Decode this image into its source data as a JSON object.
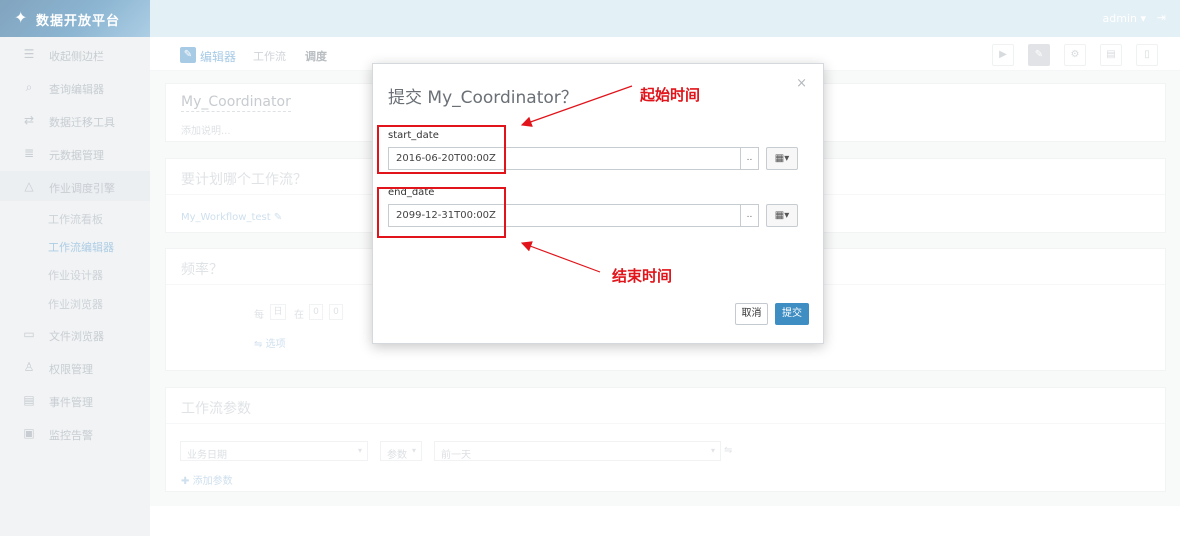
{
  "sidebar": {
    "brand": "数据开放平台",
    "items": [
      {
        "label": "收起侧边栏"
      },
      {
        "label": "查询编辑器"
      },
      {
        "label": "数据迁移工具"
      },
      {
        "label": "元数据管理"
      },
      {
        "label": "作业调度引擎"
      },
      {
        "label": "文件浏览器"
      },
      {
        "label": "权限管理"
      },
      {
        "label": "事件管理"
      },
      {
        "label": "监控告警"
      }
    ],
    "subitems": [
      "工作流看板",
      "工作流编辑器",
      "作业设计器",
      "作业浏览器"
    ]
  },
  "header": {
    "user": "admin",
    "user_caret": "▾"
  },
  "toolbar": {
    "editor": "编辑器",
    "tabs": [
      "工作流",
      "调度"
    ],
    "icons": {
      "editor": "✎",
      "play": "▶",
      "pencil": "✎",
      "gear": "⚙",
      "save": "▤",
      "file": "▯"
    }
  },
  "coordinator": {
    "name": "My_Coordinator",
    "desc_placeholder": "添加说明..."
  },
  "workflow_section": {
    "title": "要计划哪个工作流？",
    "workflow_name": "My_Workflow_test"
  },
  "frequency": {
    "title": "频率？",
    "every": "每",
    "unit": "日",
    "at": "在",
    "hour": "0",
    "minute": "0",
    "options": "选项"
  },
  "params": {
    "title": "工作流参数",
    "business_date": "业务日期",
    "param": "参数",
    "prev_day": "前一天",
    "add": "添加参数"
  },
  "modal": {
    "title": "提交 My_Coordinator？",
    "close": "×",
    "start_label": "start_date",
    "start_value": "2016-06-20T00:00Z",
    "end_label": "end_date",
    "end_value": "2099-12-31T00:00Z",
    "dots": "..",
    "cal_icon": "▦▾",
    "cancel": "取消",
    "submit": "提交"
  },
  "annotations": {
    "start": "起始时间",
    "end": "结束时间",
    "color": "#e0141a"
  },
  "colors": {
    "accent": "#3e8ec4",
    "header": "#cde3ef"
  }
}
